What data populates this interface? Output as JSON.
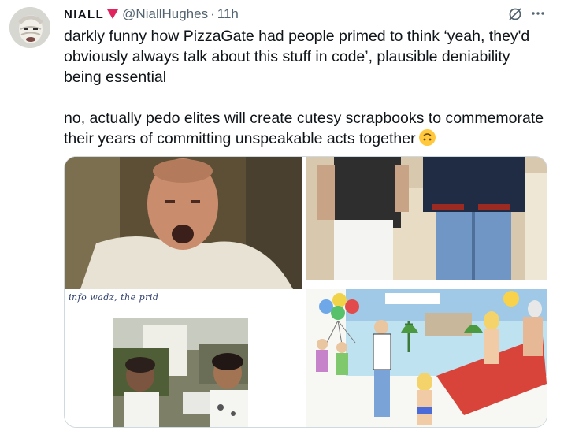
{
  "tweet": {
    "author": {
      "display_name": "NIALL",
      "flag_icon": "red-down-triangle-icon",
      "handle": "@NiallHughes",
      "separator": "·",
      "time": "11h"
    },
    "text": {
      "paragraph1": "darkly funny how PizzaGate had people primed to think ‘yeah, they'd obviously always talk about this stuff in code’, plausible deniability being essential",
      "paragraph2": "no, actually pedo elites will create cutesy scrapbooks to commemorate their years of committing unspeakable acts together",
      "emoji": "upside-down-face-emoji"
    },
    "actions": {
      "grok_icon": "grok-icon",
      "more_icon": "more-horizontal-icon"
    },
    "media": {
      "images": [
        {
          "name": "man-shouting-photo"
        },
        {
          "name": "two-men-standing-photo"
        },
        {
          "name": "scrapbook-page-two-men-photo",
          "caption": "info wadz, the prid"
        },
        {
          "name": "scrapbook-drawing-beach"
        }
      ]
    }
  },
  "colors": {
    "text": "#0f1419",
    "muted": "#536471",
    "border": "#cfd9de",
    "flag": "#e0245e"
  }
}
